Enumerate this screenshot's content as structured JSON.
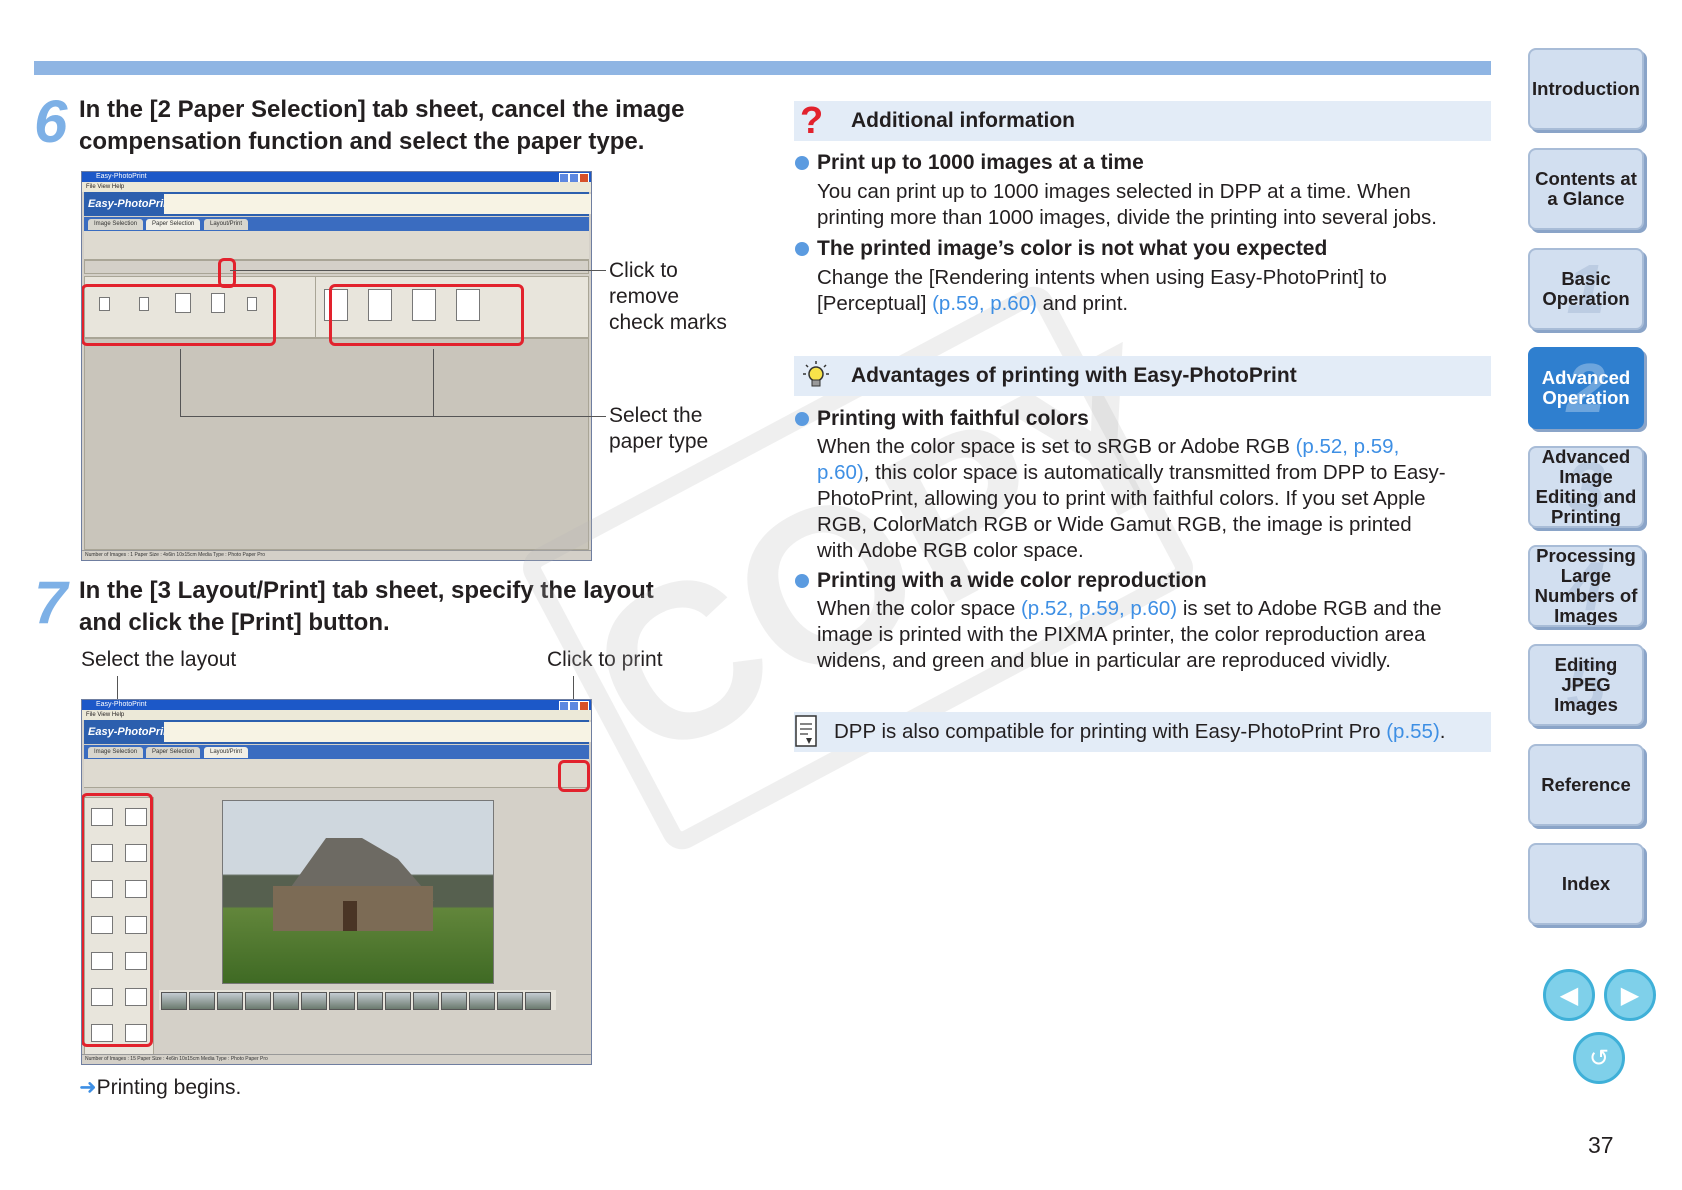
{
  "step6": {
    "number": "6",
    "title_line1": "In the [2 Paper Selection] tab sheet, cancel the image",
    "title_line2": "compensation function and select the paper type.",
    "callout_remove_1": "Click to",
    "callout_remove_2": "remove",
    "callout_remove_3": "check marks",
    "callout_paper_1": "Select the",
    "callout_paper_2": "paper type",
    "screenshot": {
      "window_title": "Easy-PhotoPrint",
      "menu": "File  View  Help",
      "logo": "Easy-PhotoPrint",
      "tabs": [
        "Image Selection",
        "Paper Selection",
        "Layout/Print"
      ],
      "status": "Number of Images : 1        Paper Size : 4x6in 10x15cm  Media Type : Photo Paper Pro"
    }
  },
  "step7": {
    "number": "7",
    "title_line1": "In the [3 Layout/Print] tab sheet, specify the layout",
    "title_line2": "and click the [Print] button.",
    "callout_layout": "Select the layout",
    "callout_print": "Click to print",
    "result": "Printing begins.",
    "screenshot": {
      "window_title": "Easy-PhotoPrint",
      "menu": "File  View  Help",
      "logo": "Easy-PhotoPrint",
      "tabs": [
        "Image Selection",
        "Paper Selection",
        "Layout/Print"
      ],
      "status": "Number of Images : 15       Paper Size : 4x6in 10x15cm  Media Type : Photo Paper Pro"
    }
  },
  "additional": {
    "heading": "Additional information",
    "item1_title": "Print up to 1000 images at a time",
    "item1_line1": "You can print up to 1000 images selected in DPP at a time. When",
    "item1_line2": "printing more than 1000 images, divide the printing into several jobs.",
    "item2_title": "The printed image’s color is not what you expected",
    "item2_line1": "Change the [Rendering intents when using Easy-PhotoPrint] to",
    "item2_line2_pre": "[Perceptual] ",
    "item2_line2_link": "(p.59, p.60)",
    "item2_line2_post": " and print."
  },
  "advantages": {
    "heading": "Advantages of printing with Easy-PhotoPrint",
    "item1_title": "Printing with faithful colors",
    "item1_line1_pre": "When the color space is set to sRGB or Adobe RGB ",
    "item1_line1_link": "(p.52, p.59,",
    "item1_line2_link": "p.60)",
    "item1_line2_post": ", this color space is automatically transmitted from DPP to Easy-",
    "item1_line3": "PhotoPrint, allowing you to print with faithful colors. If you set Apple",
    "item1_line4": "RGB, ColorMatch RGB or Wide Gamut RGB, the image is printed",
    "item1_line5": "with Adobe RGB color space.",
    "item2_title": "Printing with a wide color reproduction",
    "item2_line1_pre": "When the color space ",
    "item2_line1_link": "(p.52, p.59, p.60)",
    "item2_line1_post": " is set to Adobe RGB and the",
    "item2_line2": "image is printed with the PIXMA printer, the color reproduction area",
    "item2_line3": "widens, and green and blue in particular are reproduced vividly."
  },
  "note": {
    "text_pre": "DPP is also compatible for printing with Easy-PhotoPrint Pro ",
    "text_link": "(p.55)",
    "text_post": "."
  },
  "watermark": "COPY",
  "nav": [
    {
      "label": "Introduction",
      "num": ""
    },
    {
      "label": "Contents at a Glance",
      "num": ""
    },
    {
      "label": "Basic Operation",
      "num": "1"
    },
    {
      "label": "Advanced Operation",
      "num": "2"
    },
    {
      "label": "Advanced Image Editing and Printing",
      "num": "3"
    },
    {
      "label": "Processing Large Numbers of Images",
      "num": "4"
    },
    {
      "label": "Editing JPEG Images",
      "num": "5"
    },
    {
      "label": "Reference",
      "num": ""
    },
    {
      "label": "Index",
      "num": ""
    }
  ],
  "page_number": "37",
  "colors": {
    "accent": "#8fb5e3",
    "link": "#3e8fe4",
    "highlight_box": "#e2222d",
    "active_nav": "#2f7fcf"
  }
}
